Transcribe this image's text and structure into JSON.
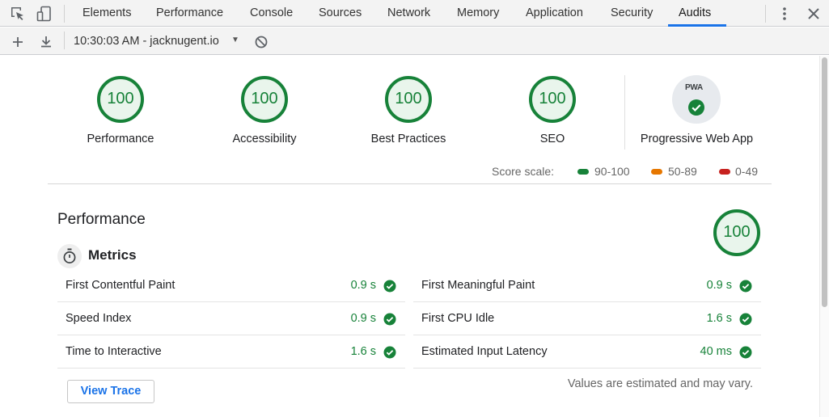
{
  "devtools": {
    "tabs": [
      {
        "label": "Elements"
      },
      {
        "label": "Performance"
      },
      {
        "label": "Console"
      },
      {
        "label": "Sources"
      },
      {
        "label": "Network"
      },
      {
        "label": "Memory"
      },
      {
        "label": "Application"
      },
      {
        "label": "Security"
      },
      {
        "label": "Audits"
      }
    ],
    "active_tab": "Audits",
    "accent_color": "#1a73e8",
    "icons": [
      "inspect-element-icon",
      "device-toolbar-icon",
      "kebab-menu-icon",
      "close-icon"
    ]
  },
  "toolbar": {
    "report_label": "10:30:03 AM - jacknugent.io",
    "icons": [
      "add-icon",
      "download-icon",
      "caret-down-icon",
      "clear-icon"
    ]
  },
  "summary": {
    "categories": [
      {
        "label": "Performance",
        "score": "100"
      },
      {
        "label": "Accessibility",
        "score": "100"
      },
      {
        "label": "Best Practices",
        "score": "100"
      },
      {
        "label": "SEO",
        "score": "100"
      }
    ],
    "pwa": {
      "badge_text": "PWA",
      "label": "Progressive Web App"
    },
    "score_scale": {
      "label": "Score scale:",
      "ranges": [
        {
          "label": "90-100",
          "color": "#178239"
        },
        {
          "label": "50-89",
          "color": "#e67700"
        },
        {
          "label": "0-49",
          "color": "#c7221f"
        }
      ]
    },
    "pass_color": "#178239"
  },
  "performance": {
    "title": "Performance",
    "score": "100",
    "metrics_heading": "Metrics",
    "metrics": [
      {
        "name": "First Contentful Paint",
        "value": "0.9 s"
      },
      {
        "name": "First Meaningful Paint",
        "value": "0.9 s"
      },
      {
        "name": "Speed Index",
        "value": "0.9 s"
      },
      {
        "name": "First CPU Idle",
        "value": "1.6 s"
      },
      {
        "name": "Time to Interactive",
        "value": "1.6 s"
      },
      {
        "name": "Estimated Input Latency",
        "value": "40 ms"
      }
    ],
    "view_trace_label": "View Trace",
    "note": "Values are estimated and may vary."
  }
}
